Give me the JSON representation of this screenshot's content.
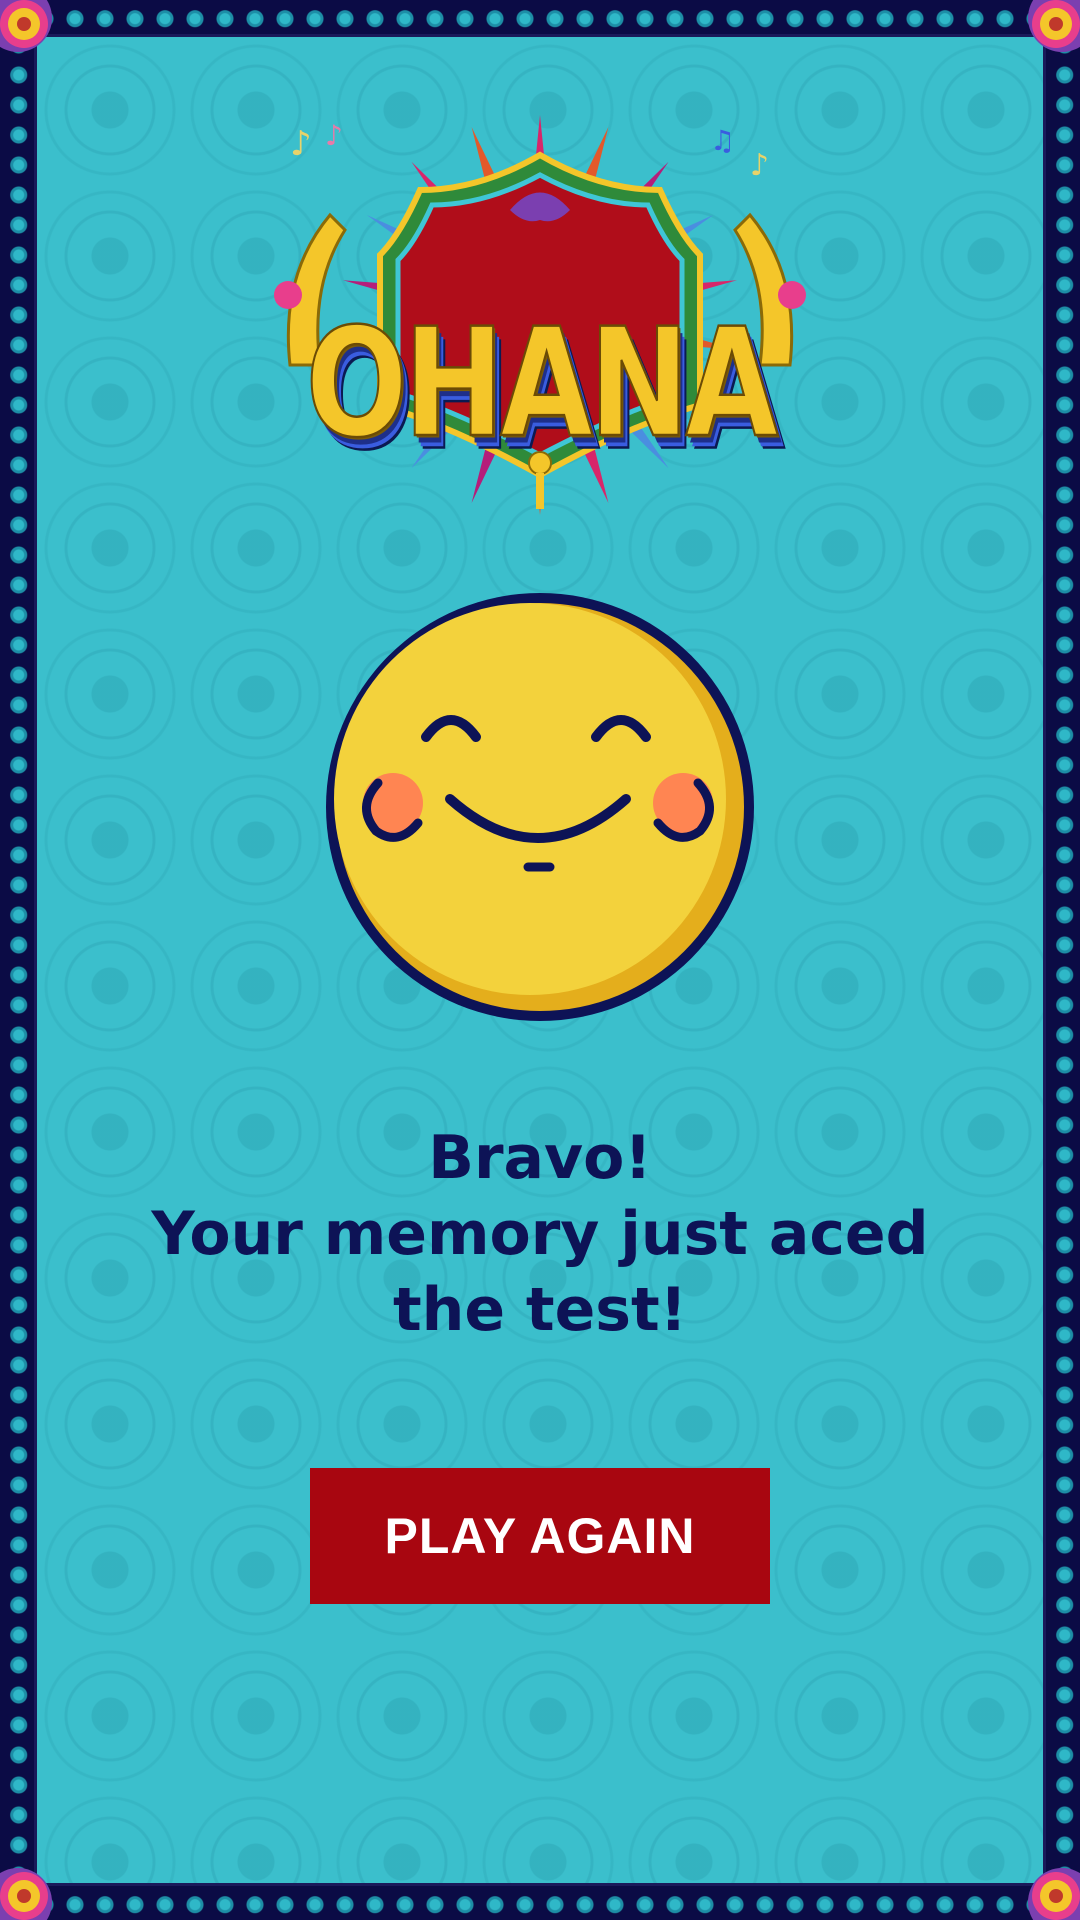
{
  "logo": {
    "text": "OHANA",
    "colors": {
      "gold": "#f4c62a",
      "red": "#b00d1a",
      "green": "#2f8a3a",
      "blue": "#3a5de0"
    }
  },
  "result": {
    "icon": "happy-smiley-face",
    "line1": "Bravo!",
    "line2": "Your memory just aced",
    "line3": "the test!"
  },
  "actions": {
    "play_again_label": "PLAY AGAIN"
  },
  "theme": {
    "background": "#3bbfcc",
    "border": "#0b0b45",
    "text": "#0d1356",
    "button": "#a80610",
    "smiley_fill": "#f3d23c",
    "smiley_shade": "#e4ae1c",
    "cheek": "#ff8552"
  }
}
